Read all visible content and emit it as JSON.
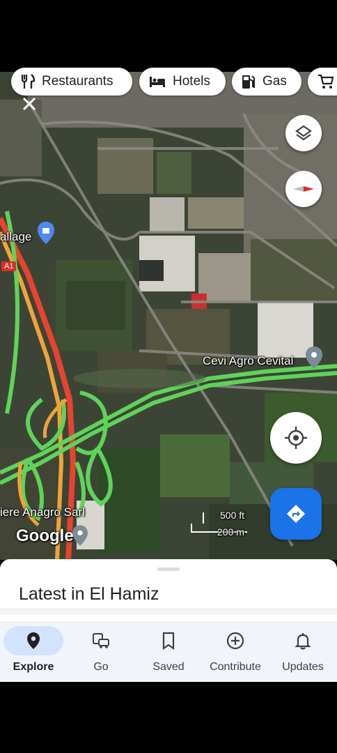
{
  "filter_chips": [
    {
      "label": "Restaurants",
      "icon": "fork-knife-icon"
    },
    {
      "label": "Hotels",
      "icon": "bed-icon"
    },
    {
      "label": "Gas",
      "icon": "gas-pump-icon"
    },
    {
      "label": "",
      "icon": "shopping-cart-icon"
    }
  ],
  "map": {
    "labels": {
      "village": "allage",
      "highway": "A1",
      "place_cevi": "Cevi Agro Cevital",
      "place_anagro": "iere Anagro Sarl",
      "google_logo": "Google"
    },
    "scale": {
      "ft": "500 ft",
      "m": "200 m"
    },
    "controls": [
      "layers-icon",
      "compass-icon",
      "my-location-icon",
      "directions-icon"
    ],
    "colors": {
      "traffic_green": "#5fd35a",
      "traffic_orange": "#f0a33a",
      "traffic_red": "#e8432f",
      "directions_blue": "#1a73e8"
    }
  },
  "sheet": {
    "title": "Latest in El Hamiz"
  },
  "bottom_nav": [
    {
      "label": "Explore",
      "icon": "explore-pin-icon",
      "active": true
    },
    {
      "label": "Go",
      "icon": "commute-icon",
      "active": false
    },
    {
      "label": "Saved",
      "icon": "bookmark-icon",
      "active": false
    },
    {
      "label": "Contribute",
      "icon": "add-circle-icon",
      "active": false
    },
    {
      "label": "Updates",
      "icon": "bell-icon",
      "active": false
    }
  ]
}
